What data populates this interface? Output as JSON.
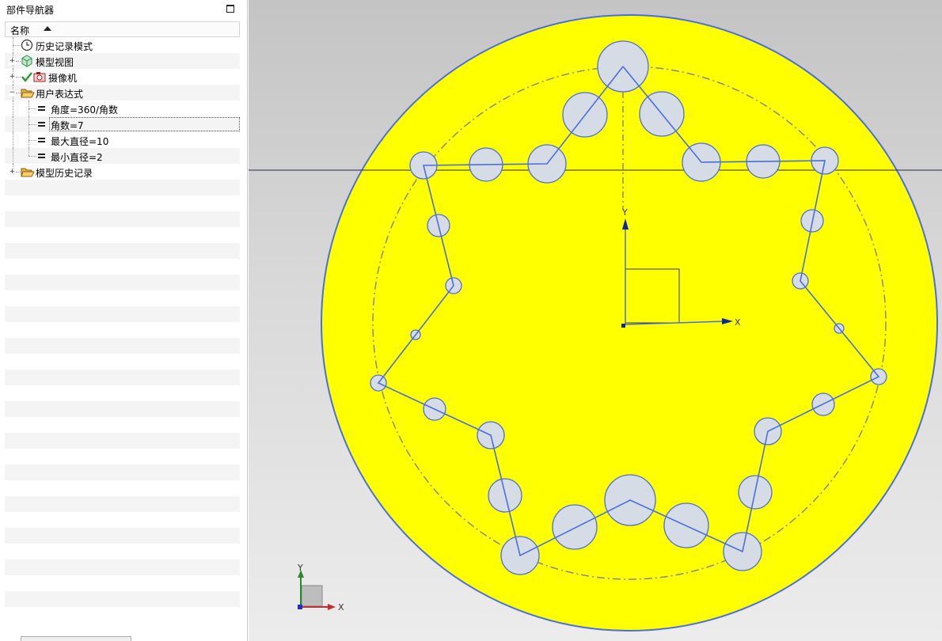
{
  "navigator": {
    "title": "部件导航器",
    "column_header": "名称",
    "items": [
      {
        "label": "历史记录模式",
        "icon": "clock-icon"
      },
      {
        "label": "模型视图",
        "icon": "model-views-icon",
        "expander": "+"
      },
      {
        "label": "摄像机",
        "icon": "camera-icon",
        "expander": "+",
        "checked": true
      },
      {
        "label": "用户表达式",
        "icon": "open-folder-icon",
        "expander": "−"
      },
      {
        "label": "角度=360/角数",
        "icon": "expression-icon"
      },
      {
        "label": "角数=7",
        "icon": "expression-icon",
        "selected": true
      },
      {
        "label": "最大直径=10",
        "icon": "expression-icon"
      },
      {
        "label": "最小直径=2",
        "icon": "expression-icon"
      },
      {
        "label": "模型历史记录",
        "icon": "folder-icon",
        "expander": "+"
      }
    ]
  },
  "viewport": {
    "csys_x_label": "X",
    "csys_y_label": "Y",
    "triad_x_label": "X",
    "triad_y_label": "Y",
    "colors": {
      "part_fill": "#ffff00",
      "edge": "#4a6fd8",
      "hole_fill": "#d6dce6",
      "horizon": "#2a2a50",
      "pitch_circle": "#888888"
    }
  }
}
